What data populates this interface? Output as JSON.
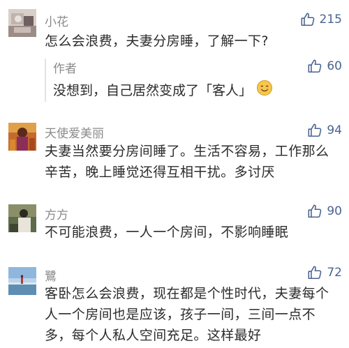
{
  "comments": [
    {
      "username": "小花",
      "likes": "215",
      "text": "怎么会浪费，夫妻分房睡，了解一下?",
      "reply": {
        "author": "作者",
        "likes": "60",
        "text": "没想到，自己居然变成了「客人」",
        "emoji": "smiling-face-emoji"
      }
    },
    {
      "username": "天使爱美丽",
      "likes": "94",
      "text": "夫妻当然要分房间睡了。生活不容易，工作那么辛苦，晚上睡觉还得互相干扰。多讨厌"
    },
    {
      "username": "方方",
      "likes": "90",
      "text": "不可能浪费，一人一个房间，不影响睡眠"
    },
    {
      "username": "鷺",
      "likes": "72",
      "text": "客卧怎么会浪费，现在都是个性时代，夫妻每个人一个房间也是应该，孩子一间，三间一点不多，每个人私人空间充足。这样最好"
    }
  ],
  "icons": {
    "like": "thumbs-up-outline-icon"
  },
  "colors": {
    "like_accent": "#4a6390",
    "username": "#8a8a8a",
    "text": "#2b2b2b",
    "emoji_face": "#f6c84a"
  }
}
